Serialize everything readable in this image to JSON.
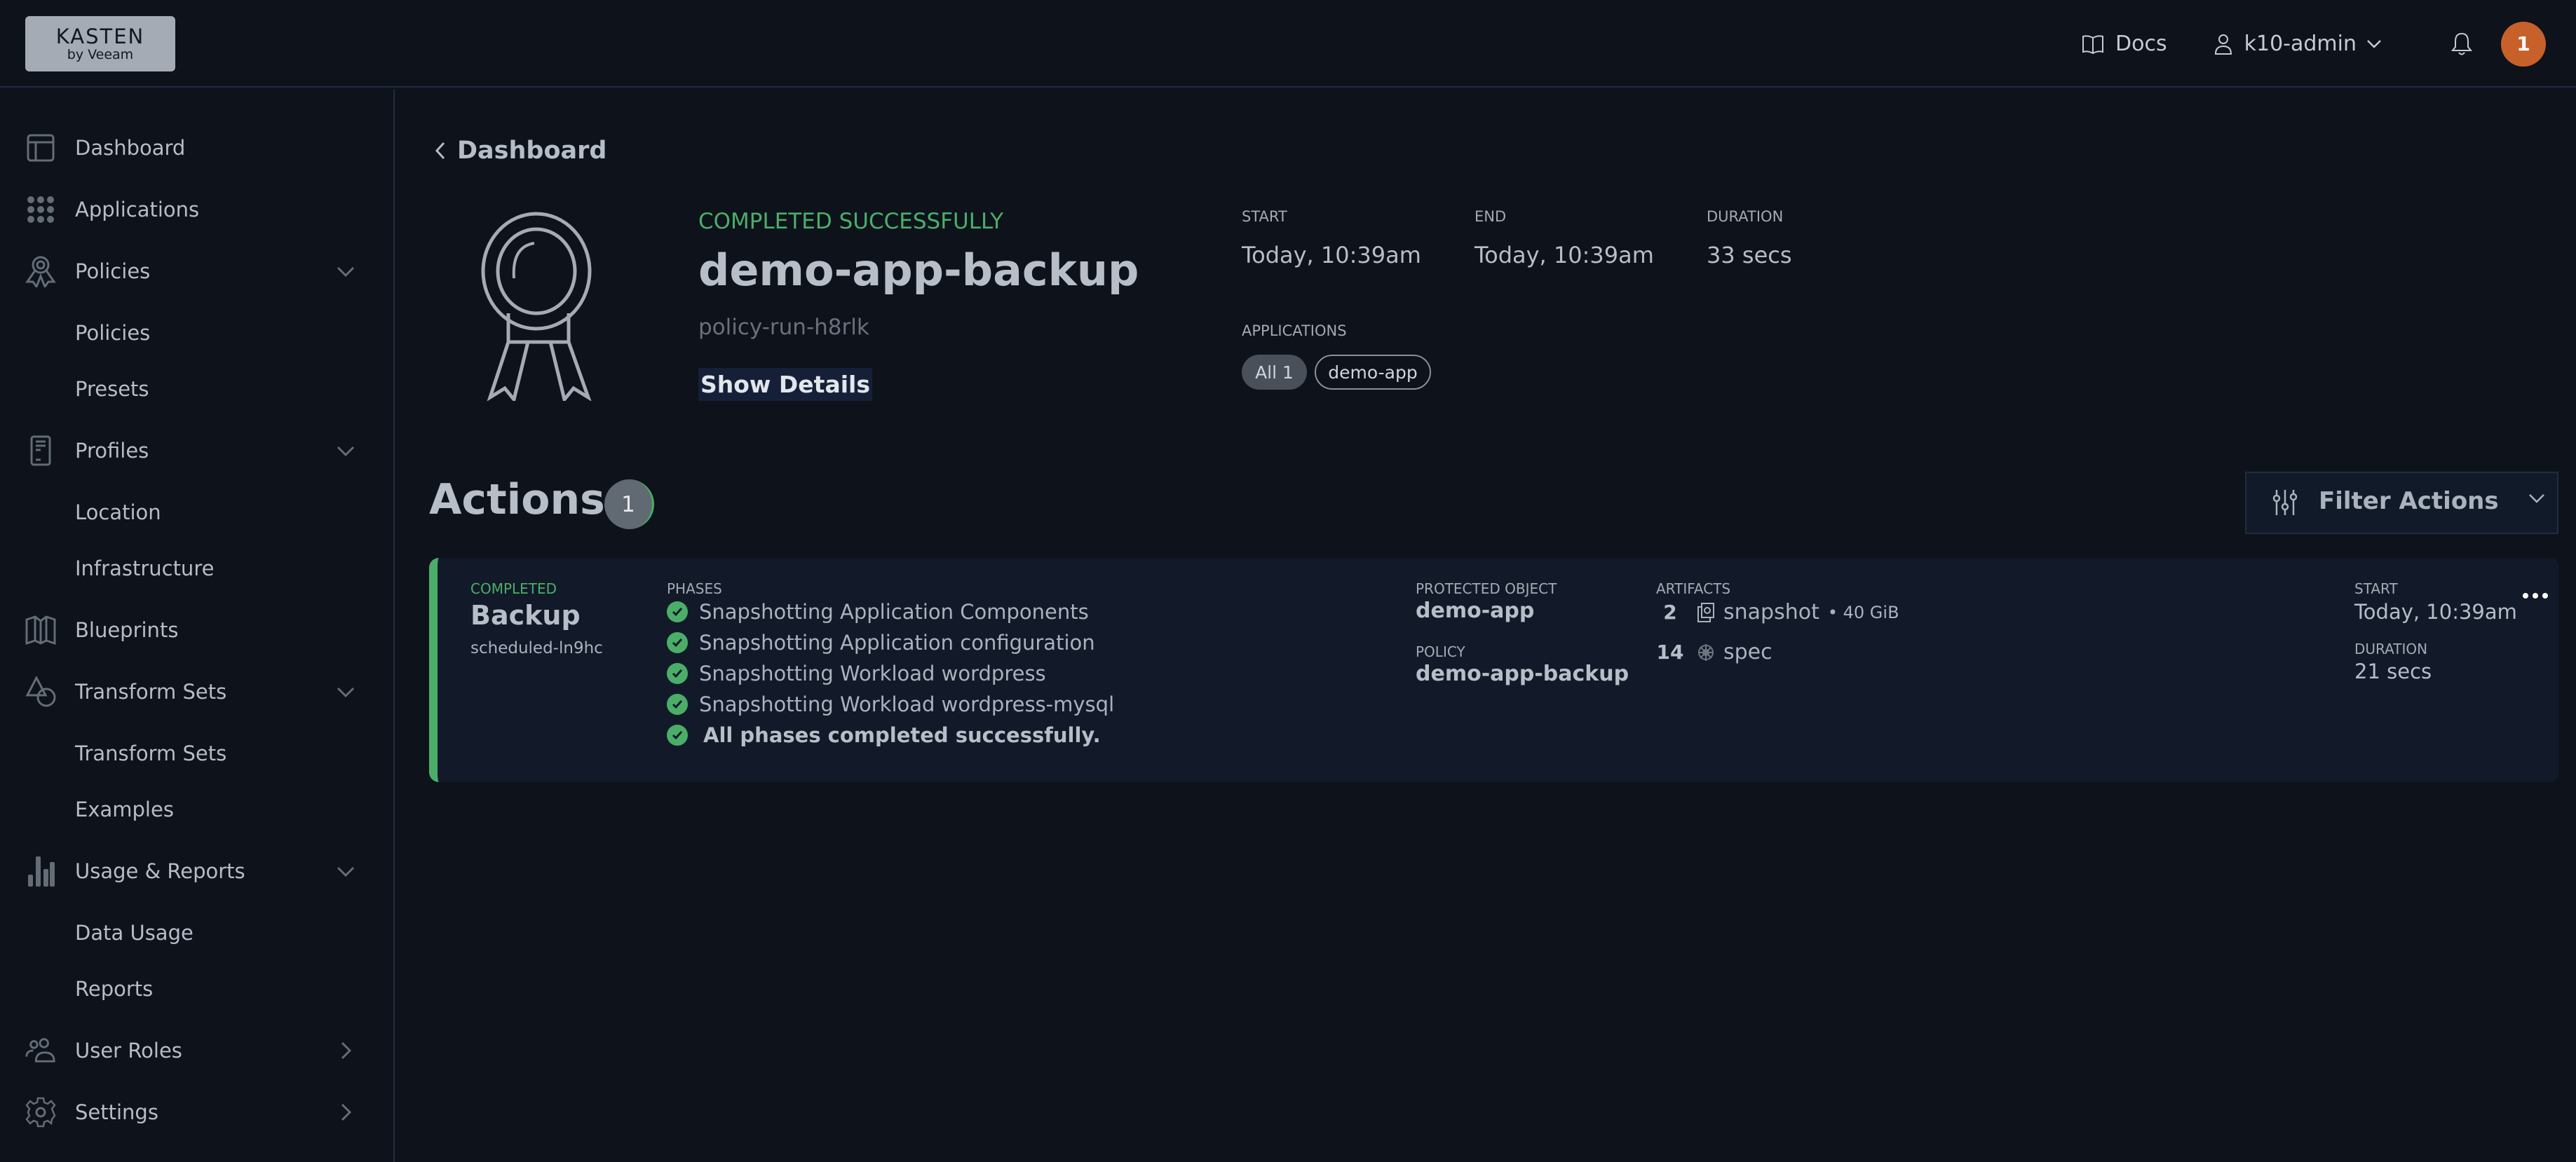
{
  "header": {
    "logo_line1": "KASTEN",
    "logo_line2": "by Veeam",
    "docs_label": "Docs",
    "user_label": "k10-admin",
    "notification_count": "1"
  },
  "sidebar": {
    "items": [
      {
        "label": "Dashboard",
        "icon": "dashboard-icon"
      },
      {
        "label": "Applications",
        "icon": "apps-grid-icon"
      },
      {
        "label": "Policies",
        "icon": "award-icon",
        "expanded": true
      },
      {
        "label": "Policies",
        "sub": true
      },
      {
        "label": "Presets",
        "sub": true
      },
      {
        "label": "Profiles",
        "icon": "profile-doc-icon",
        "expanded": true
      },
      {
        "label": "Location",
        "sub": true
      },
      {
        "label": "Infrastructure",
        "sub": true
      },
      {
        "label": "Blueprints",
        "icon": "map-icon"
      },
      {
        "label": "Transform Sets",
        "icon": "shapes-icon",
        "expanded": true
      },
      {
        "label": "Transform Sets",
        "sub": true
      },
      {
        "label": "Examples",
        "sub": true
      },
      {
        "label": "Usage & Reports",
        "icon": "bar-chart-icon",
        "expanded": true
      },
      {
        "label": "Data Usage",
        "sub": true
      },
      {
        "label": "Reports",
        "sub": true
      },
      {
        "label": "User Roles",
        "icon": "users-icon",
        "expanded": false
      },
      {
        "label": "Settings",
        "icon": "gear-icon",
        "expanded": false
      }
    ]
  },
  "main": {
    "back_label": "Dashboard",
    "run": {
      "status": "COMPLETED SUCCESSFULLY",
      "title": "demo-app-backup",
      "id": "policy-run-h8rlk",
      "show_details_label": "Show Details",
      "start_label": "START",
      "start_value": "Today, 10:39am",
      "end_label": "END",
      "end_value": "Today, 10:39am",
      "duration_label": "DURATION",
      "duration_value": "33 secs",
      "applications_label": "APPLICATIONS",
      "applications_all": "All 1",
      "applications": [
        "demo-app"
      ]
    },
    "actions_title": "Actions",
    "actions_count": "1",
    "filter_label": "Filter Actions",
    "actions": [
      {
        "status": "COMPLETED",
        "type": "Backup",
        "id": "scheduled-ln9hc",
        "phases_label": "PHASES",
        "phases": [
          "Snapshotting Application Components",
          "Snapshotting Application configuration",
          "Snapshotting Workload wordpress",
          "Snapshotting Workload wordpress-mysql"
        ],
        "phases_summary": "All phases completed successfully.",
        "protected_object_label": "PROTECTED OBJECT",
        "protected_object": "demo-app",
        "policy_label": "POLICY",
        "policy": "demo-app-backup",
        "artifacts_label": "ARTIFACTS",
        "artifacts": [
          {
            "count": "2",
            "name": "snapshot",
            "size": "• 40 GiB",
            "icon": "snapshot-icon"
          },
          {
            "count": "14",
            "name": "spec",
            "size": "",
            "icon": "helm-wheel-icon"
          }
        ],
        "start_label": "START",
        "start_value": "Today, 10:39am",
        "duration_label": "DURATION",
        "duration_value": "21 secs"
      }
    ]
  },
  "colors": {
    "background": "#0d121b",
    "success": "#4bae68",
    "notification": "#c8602a",
    "card": "#121a29"
  }
}
